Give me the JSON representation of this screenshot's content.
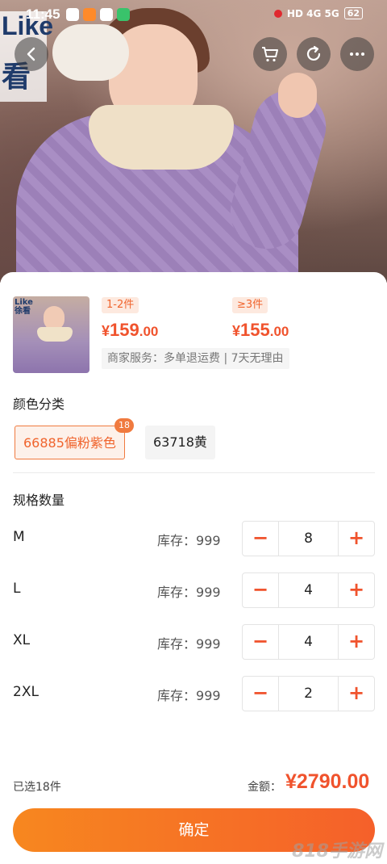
{
  "status_bar": {
    "time": "11:45",
    "network": "HD 4G 5G",
    "battery": "62"
  },
  "hero": {
    "brand_line1": "Like",
    "brand_line2": "看"
  },
  "header_icons": {
    "back": "chevron-left-icon",
    "cart": "cart-icon",
    "share": "share-icon",
    "more": "more-icon"
  },
  "product": {
    "thumb_brand_line1": "Like",
    "thumb_brand_line2": "徐看",
    "tiers": [
      {
        "label": "1-2件",
        "currency": "¥",
        "price_int": "159",
        "price_dec": ".00"
      },
      {
        "label": "≥3件",
        "currency": "¥",
        "price_int": "155",
        "price_dec": ".00"
      }
    ],
    "service": "商家服务：多单退运费 | 7天无理由"
  },
  "color_section": {
    "title": "颜色分类",
    "options": [
      {
        "label": "66885偏粉紫色",
        "selected": true,
        "badge": "18"
      },
      {
        "label": "63718黄",
        "selected": false
      }
    ]
  },
  "spec_section": {
    "title": "规格数量",
    "stock_label": "库存：",
    "minus": "−",
    "plus": "+",
    "rows": [
      {
        "size": "M",
        "stock": "999",
        "qty": "8"
      },
      {
        "size": "L",
        "stock": "999",
        "qty": "4"
      },
      {
        "size": "XL",
        "stock": "999",
        "qty": "4"
      },
      {
        "size": "2XL",
        "stock": "999",
        "qty": "2"
      }
    ]
  },
  "footer": {
    "selected": "已选18件",
    "total_label": "金额：",
    "total_amount": "¥2790.00",
    "confirm": "确定"
  },
  "watermark": "818手游网",
  "colors": {
    "accent": "#f0532d",
    "button_start": "#f7871f",
    "button_end": "#f5602a"
  }
}
